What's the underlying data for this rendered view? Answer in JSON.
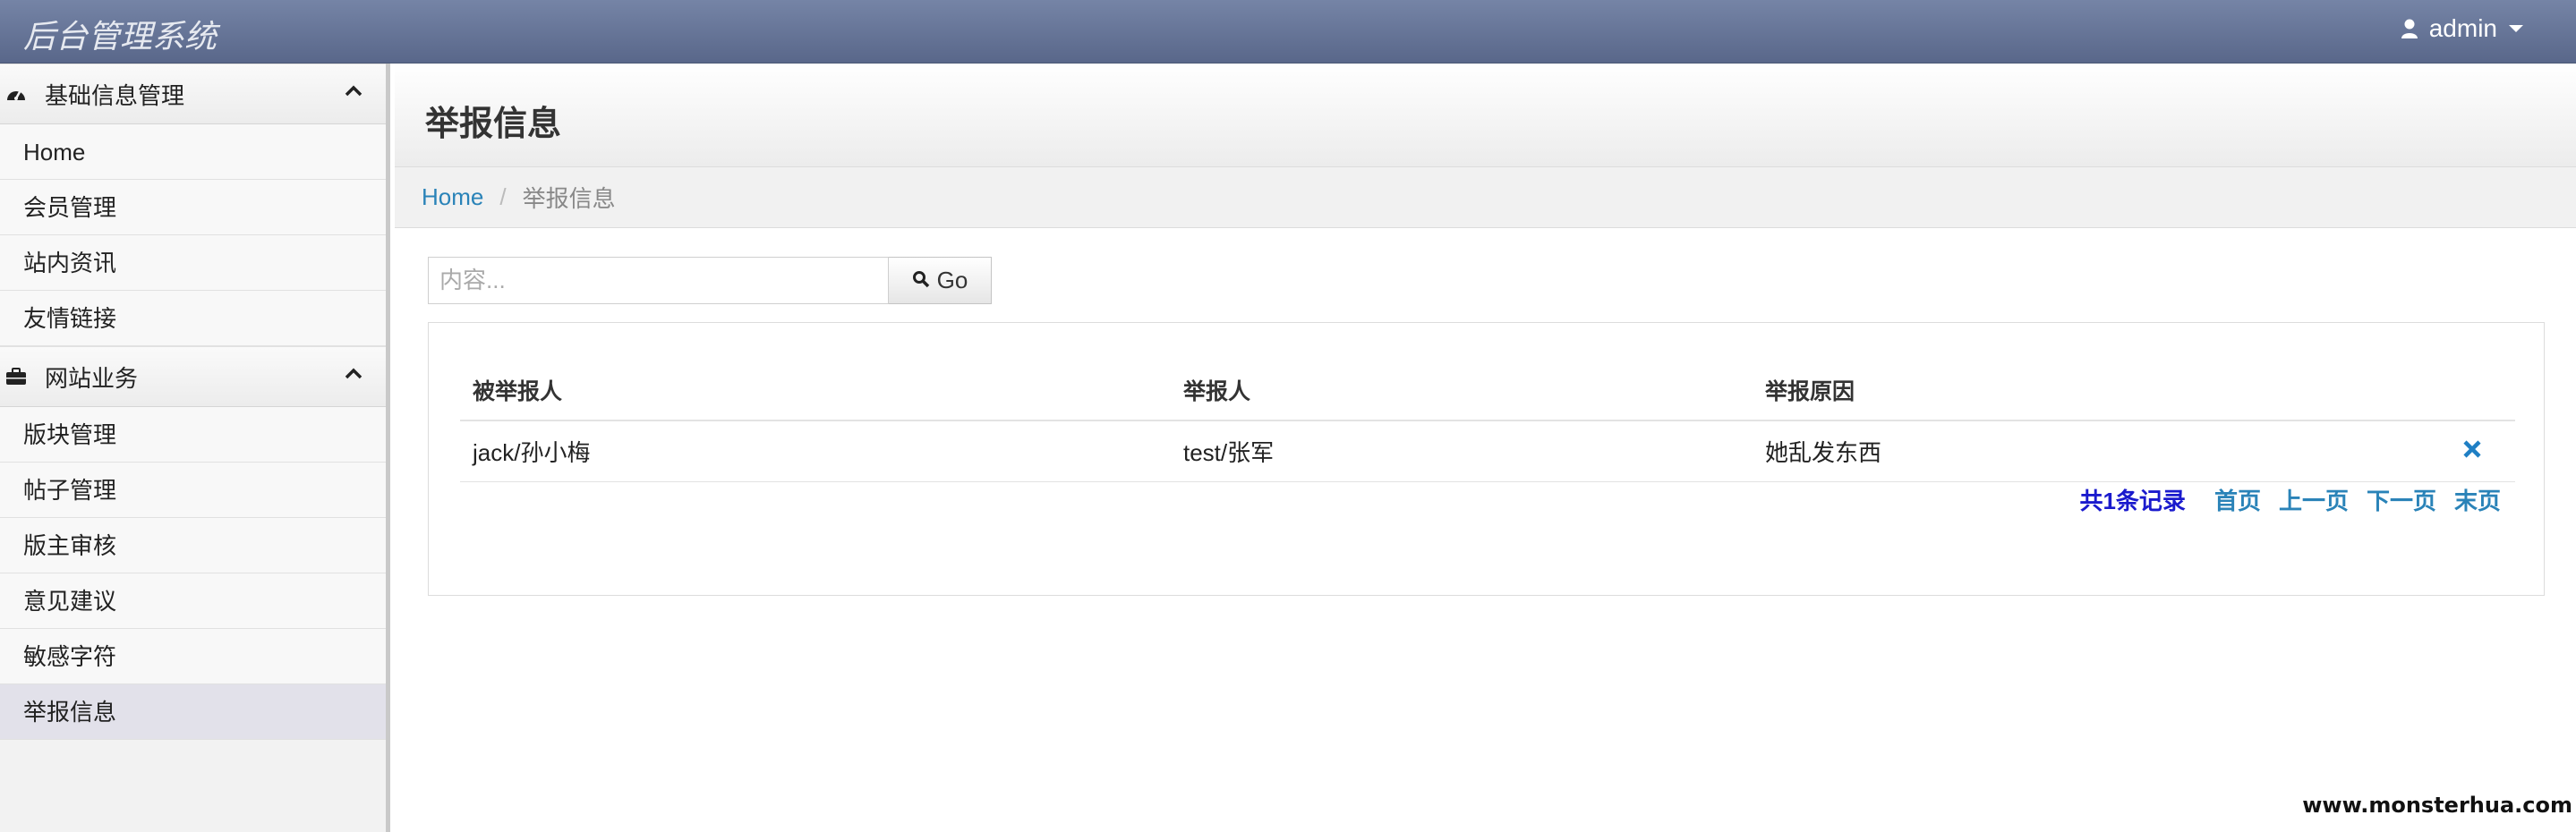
{
  "app": {
    "brand": "后台管理系统"
  },
  "user": {
    "name": "admin"
  },
  "sidebar": {
    "groups": [
      {
        "title": "基础信息管理",
        "icon": "dashboard-icon",
        "items": [
          {
            "label": "Home"
          },
          {
            "label": "会员管理"
          },
          {
            "label": "站内资讯"
          },
          {
            "label": "友情链接"
          }
        ]
      },
      {
        "title": "网站业务",
        "icon": "briefcase-icon",
        "items": [
          {
            "label": "版块管理"
          },
          {
            "label": "帖子管理"
          },
          {
            "label": "版主审核"
          },
          {
            "label": "意见建议"
          },
          {
            "label": "敏感字符"
          },
          {
            "label": "举报信息"
          }
        ]
      }
    ]
  },
  "page": {
    "title": "举报信息"
  },
  "breadcrumb": {
    "home": "Home",
    "separator": "/",
    "current": "举报信息"
  },
  "search": {
    "placeholder": "内容...",
    "value": "",
    "button": "Go"
  },
  "table": {
    "headers": [
      "被举报人",
      "举报人",
      "举报原因"
    ],
    "rows": [
      {
        "reported": "jack/孙小梅",
        "reporter": "test/张军",
        "reason": "她乱发东西"
      }
    ]
  },
  "pager": {
    "total": "共1条记录",
    "first": "首页",
    "prev": "上一页",
    "next": "下一页",
    "last": "末页"
  },
  "watermark": "www.monsterhua.com",
  "colors": {
    "navbar": "#6a789b",
    "link": "#2a83b8",
    "total": "#1a1acd",
    "active_item": "#e2e1ea"
  }
}
